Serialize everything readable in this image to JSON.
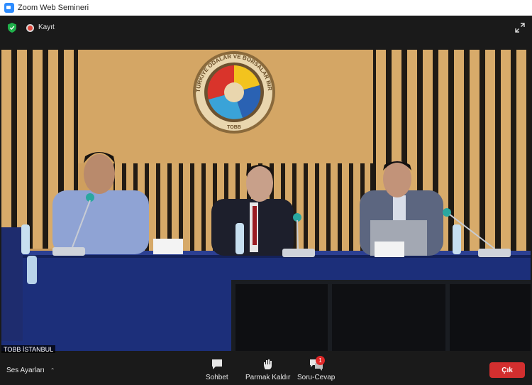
{
  "window": {
    "title": "Zoom Web Semineri"
  },
  "topbar": {
    "recording_label": "Kayıt"
  },
  "video": {
    "participant_name": "TOBB İSTANBUL",
    "emblem_text": "TÜRKİYE ODALAR VE BORSALAR BİRLİĞİ",
    "emblem_short": "TOBB"
  },
  "bottombar": {
    "audio_label": "Ses Ayarları",
    "chat_label": "Sohbet",
    "raise_hand_label": "Parmak Kaldır",
    "qa_label": "Soru-Cevap",
    "qa_badge": "1",
    "leave_label": "Çık"
  },
  "colors": {
    "accent": "#2d8cff",
    "leave": "#d32f2f",
    "badge": "#e02828",
    "secure": "#20b04b"
  }
}
